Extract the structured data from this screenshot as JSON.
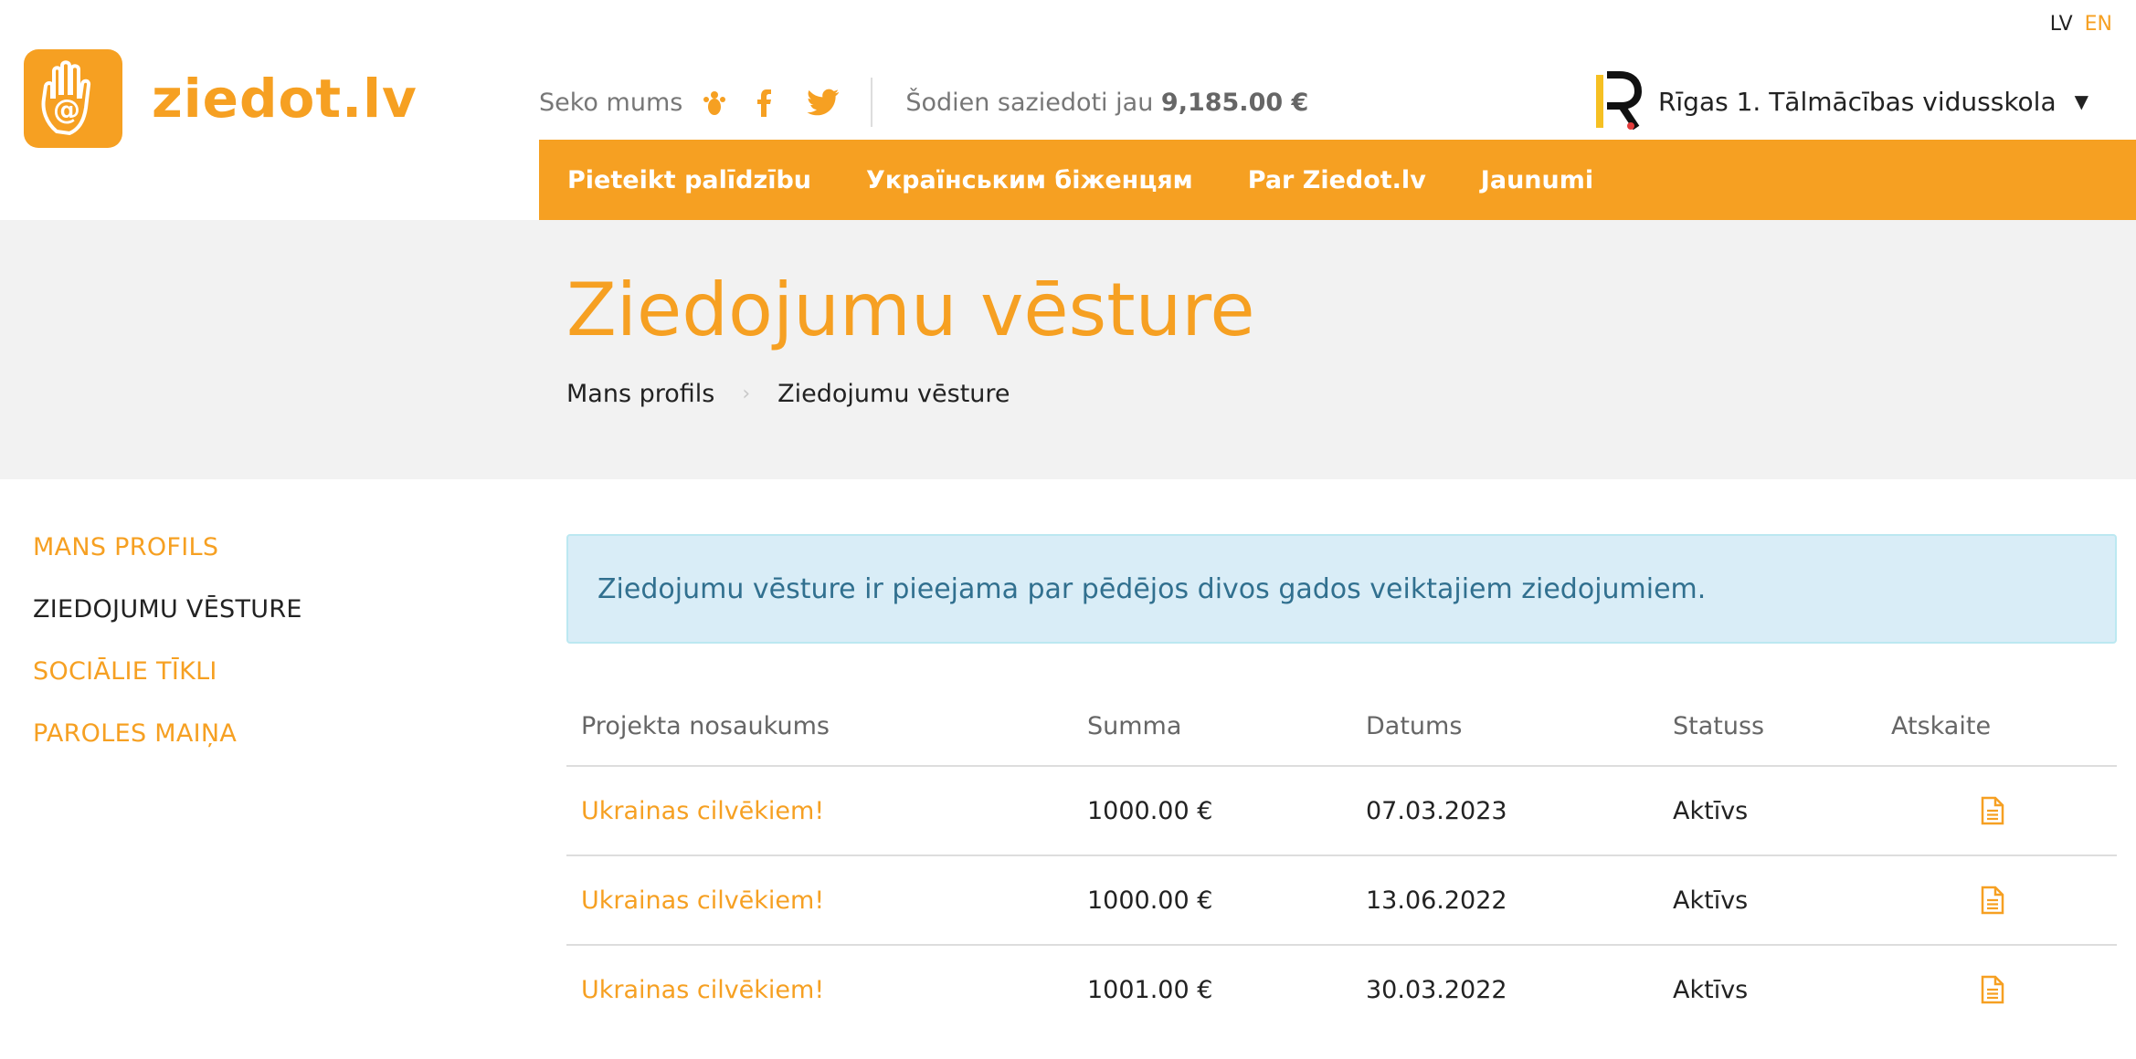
{
  "lang": {
    "lv": "LV",
    "en": "EN"
  },
  "brand": {
    "name": "ziedot.lv",
    "color": "#f6a022"
  },
  "header": {
    "follow_label": "Seko mums",
    "social_icons": [
      "draugiem-icon",
      "facebook-icon",
      "twitter-icon"
    ],
    "counter_prefix": "Šodien saziedoti jau",
    "counter_amount": "9,185.00 €"
  },
  "org": {
    "name": "Rīgas 1. Tālmācības vidusskola",
    "caret": "▼"
  },
  "nav": {
    "items": [
      {
        "label": "Pieteikt palīdzību"
      },
      {
        "label": "Українським біженцям"
      },
      {
        "label": "Par Ziedot.lv"
      },
      {
        "label": "Jaunumi"
      }
    ]
  },
  "page": {
    "title": "Ziedojumu vēsture",
    "breadcrumb": [
      "Mans profils",
      "Ziedojumu vēsture"
    ]
  },
  "sidebar": {
    "items": [
      {
        "label": "MANS PROFILS",
        "active": false
      },
      {
        "label": "ZIEDOJUMU VĒSTURE",
        "active": true
      },
      {
        "label": "SOCIĀLIE TĪKLI",
        "active": false
      },
      {
        "label": "PAROLES MAIŅA",
        "active": false
      }
    ]
  },
  "alert": {
    "text": "Ziedojumu vēsture ir pieejama par pēdējos divos gados veiktajiem ziedojumiem."
  },
  "table": {
    "headers": [
      "Projekta nosaukums",
      "Summa",
      "Datums",
      "Statuss",
      "Atskaite"
    ],
    "rows": [
      {
        "project": "Ukrainas cilvēkiem!",
        "amount": "1000.00 €",
        "date": "07.03.2023",
        "status": "Aktīvs",
        "report_icon": "document-icon"
      },
      {
        "project": "Ukrainas cilvēkiem!",
        "amount": "1000.00 €",
        "date": "13.06.2022",
        "status": "Aktīvs",
        "report_icon": "document-icon"
      },
      {
        "project": "Ukrainas cilvēkiem!",
        "amount": "1001.00 €",
        "date": "30.03.2022",
        "status": "Aktīvs",
        "report_icon": "document-icon"
      }
    ]
  }
}
